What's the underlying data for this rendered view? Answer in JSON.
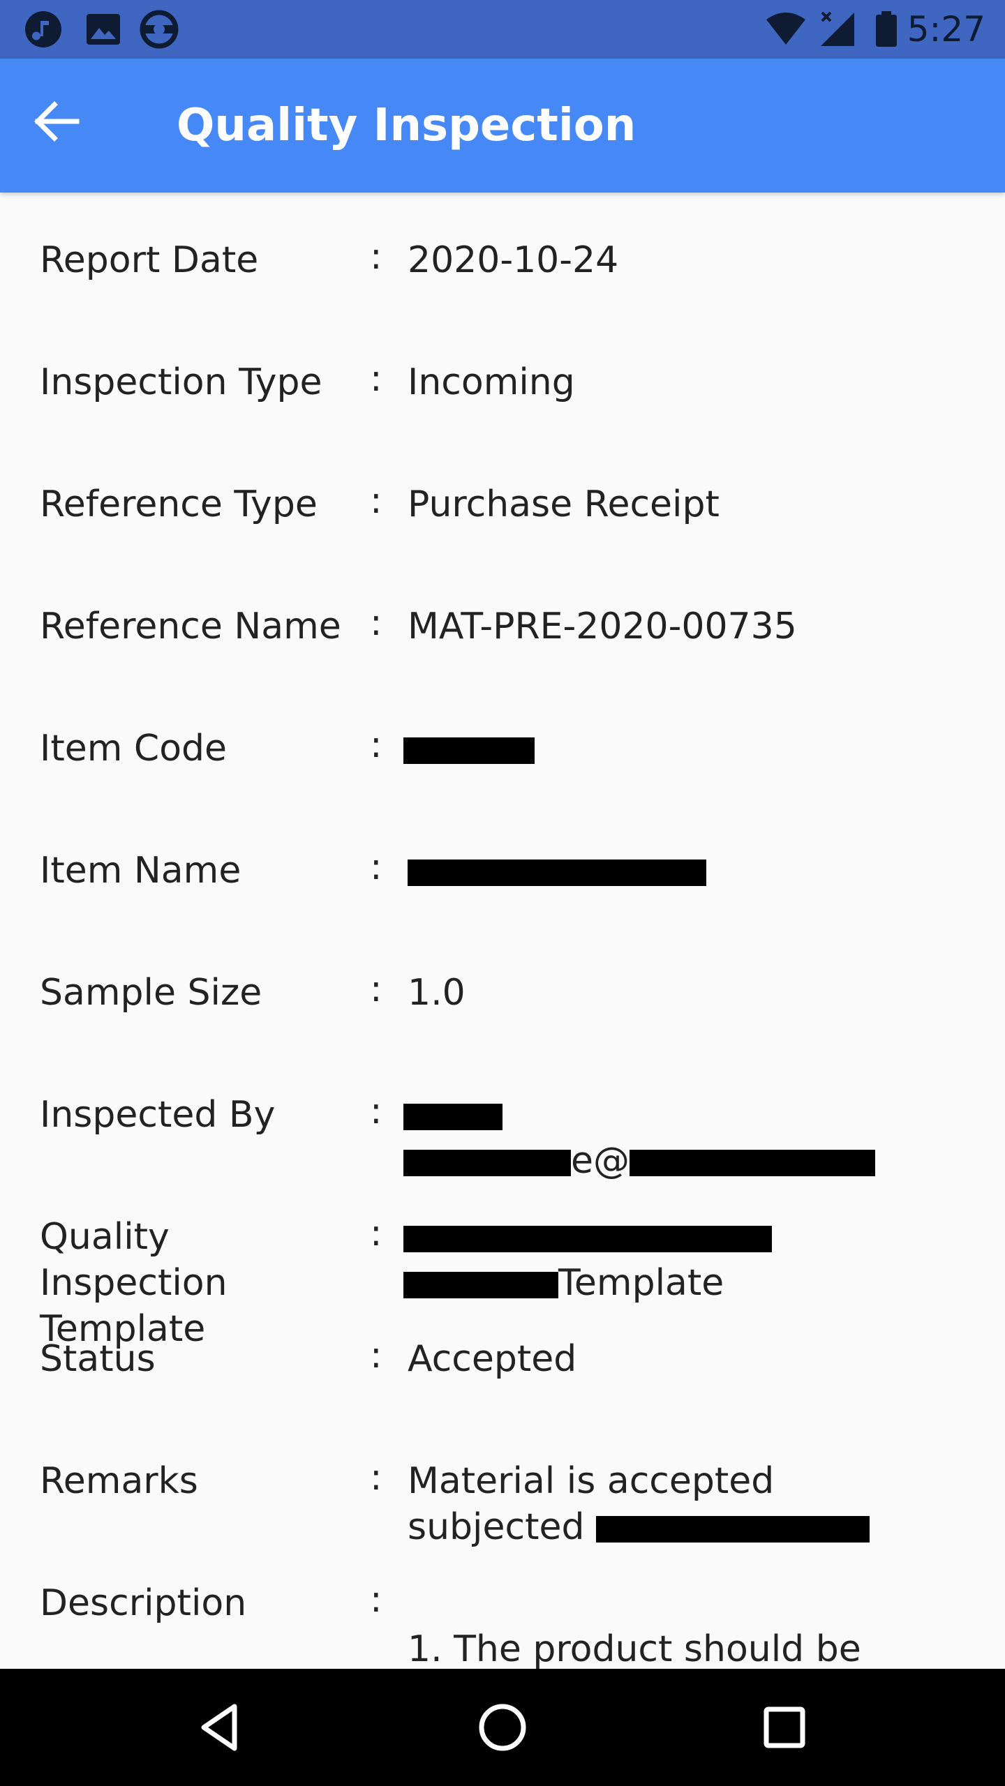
{
  "status_bar": {
    "time": "5:27",
    "left_icons": [
      "music-note-icon",
      "image-icon",
      "sync-icon"
    ],
    "right_icons": [
      "wifi-icon",
      "cellular-signal-icon",
      "battery-icon"
    ]
  },
  "app_bar": {
    "title": "Quality Inspection",
    "background": "#4588f6"
  },
  "fields": [
    {
      "label": "Report Date",
      "value": "2020-10-24"
    },
    {
      "label": "Inspection Type",
      "value": "Incoming"
    },
    {
      "label": "Reference Type",
      "value": "Purchase Receipt"
    },
    {
      "label": "Reference Name",
      "value": "MAT-PRE-2020-00735"
    },
    {
      "label": "Item Code",
      "value": ""
    },
    {
      "label": "Item Name",
      "value": ""
    },
    {
      "label": "Sample Size",
      "value": "1.0"
    },
    {
      "label": "Inspected By",
      "value_line2_visible": "e@"
    },
    {
      "label_line1": "Quality Inspection",
      "label_line2": "Template",
      "value_line2_visible": "Template"
    },
    {
      "label": "Status",
      "value": "Accepted"
    },
    {
      "label": "Remarks",
      "value_line1": "Material is accepted",
      "value_line2": "subjected "
    },
    {
      "label": "Description",
      "value_line2": "1. The product should be"
    }
  ],
  "colon": ":",
  "nav_bar": {
    "buttons": [
      "back-triangle-icon",
      "home-circle-icon",
      "recents-square-icon"
    ]
  }
}
